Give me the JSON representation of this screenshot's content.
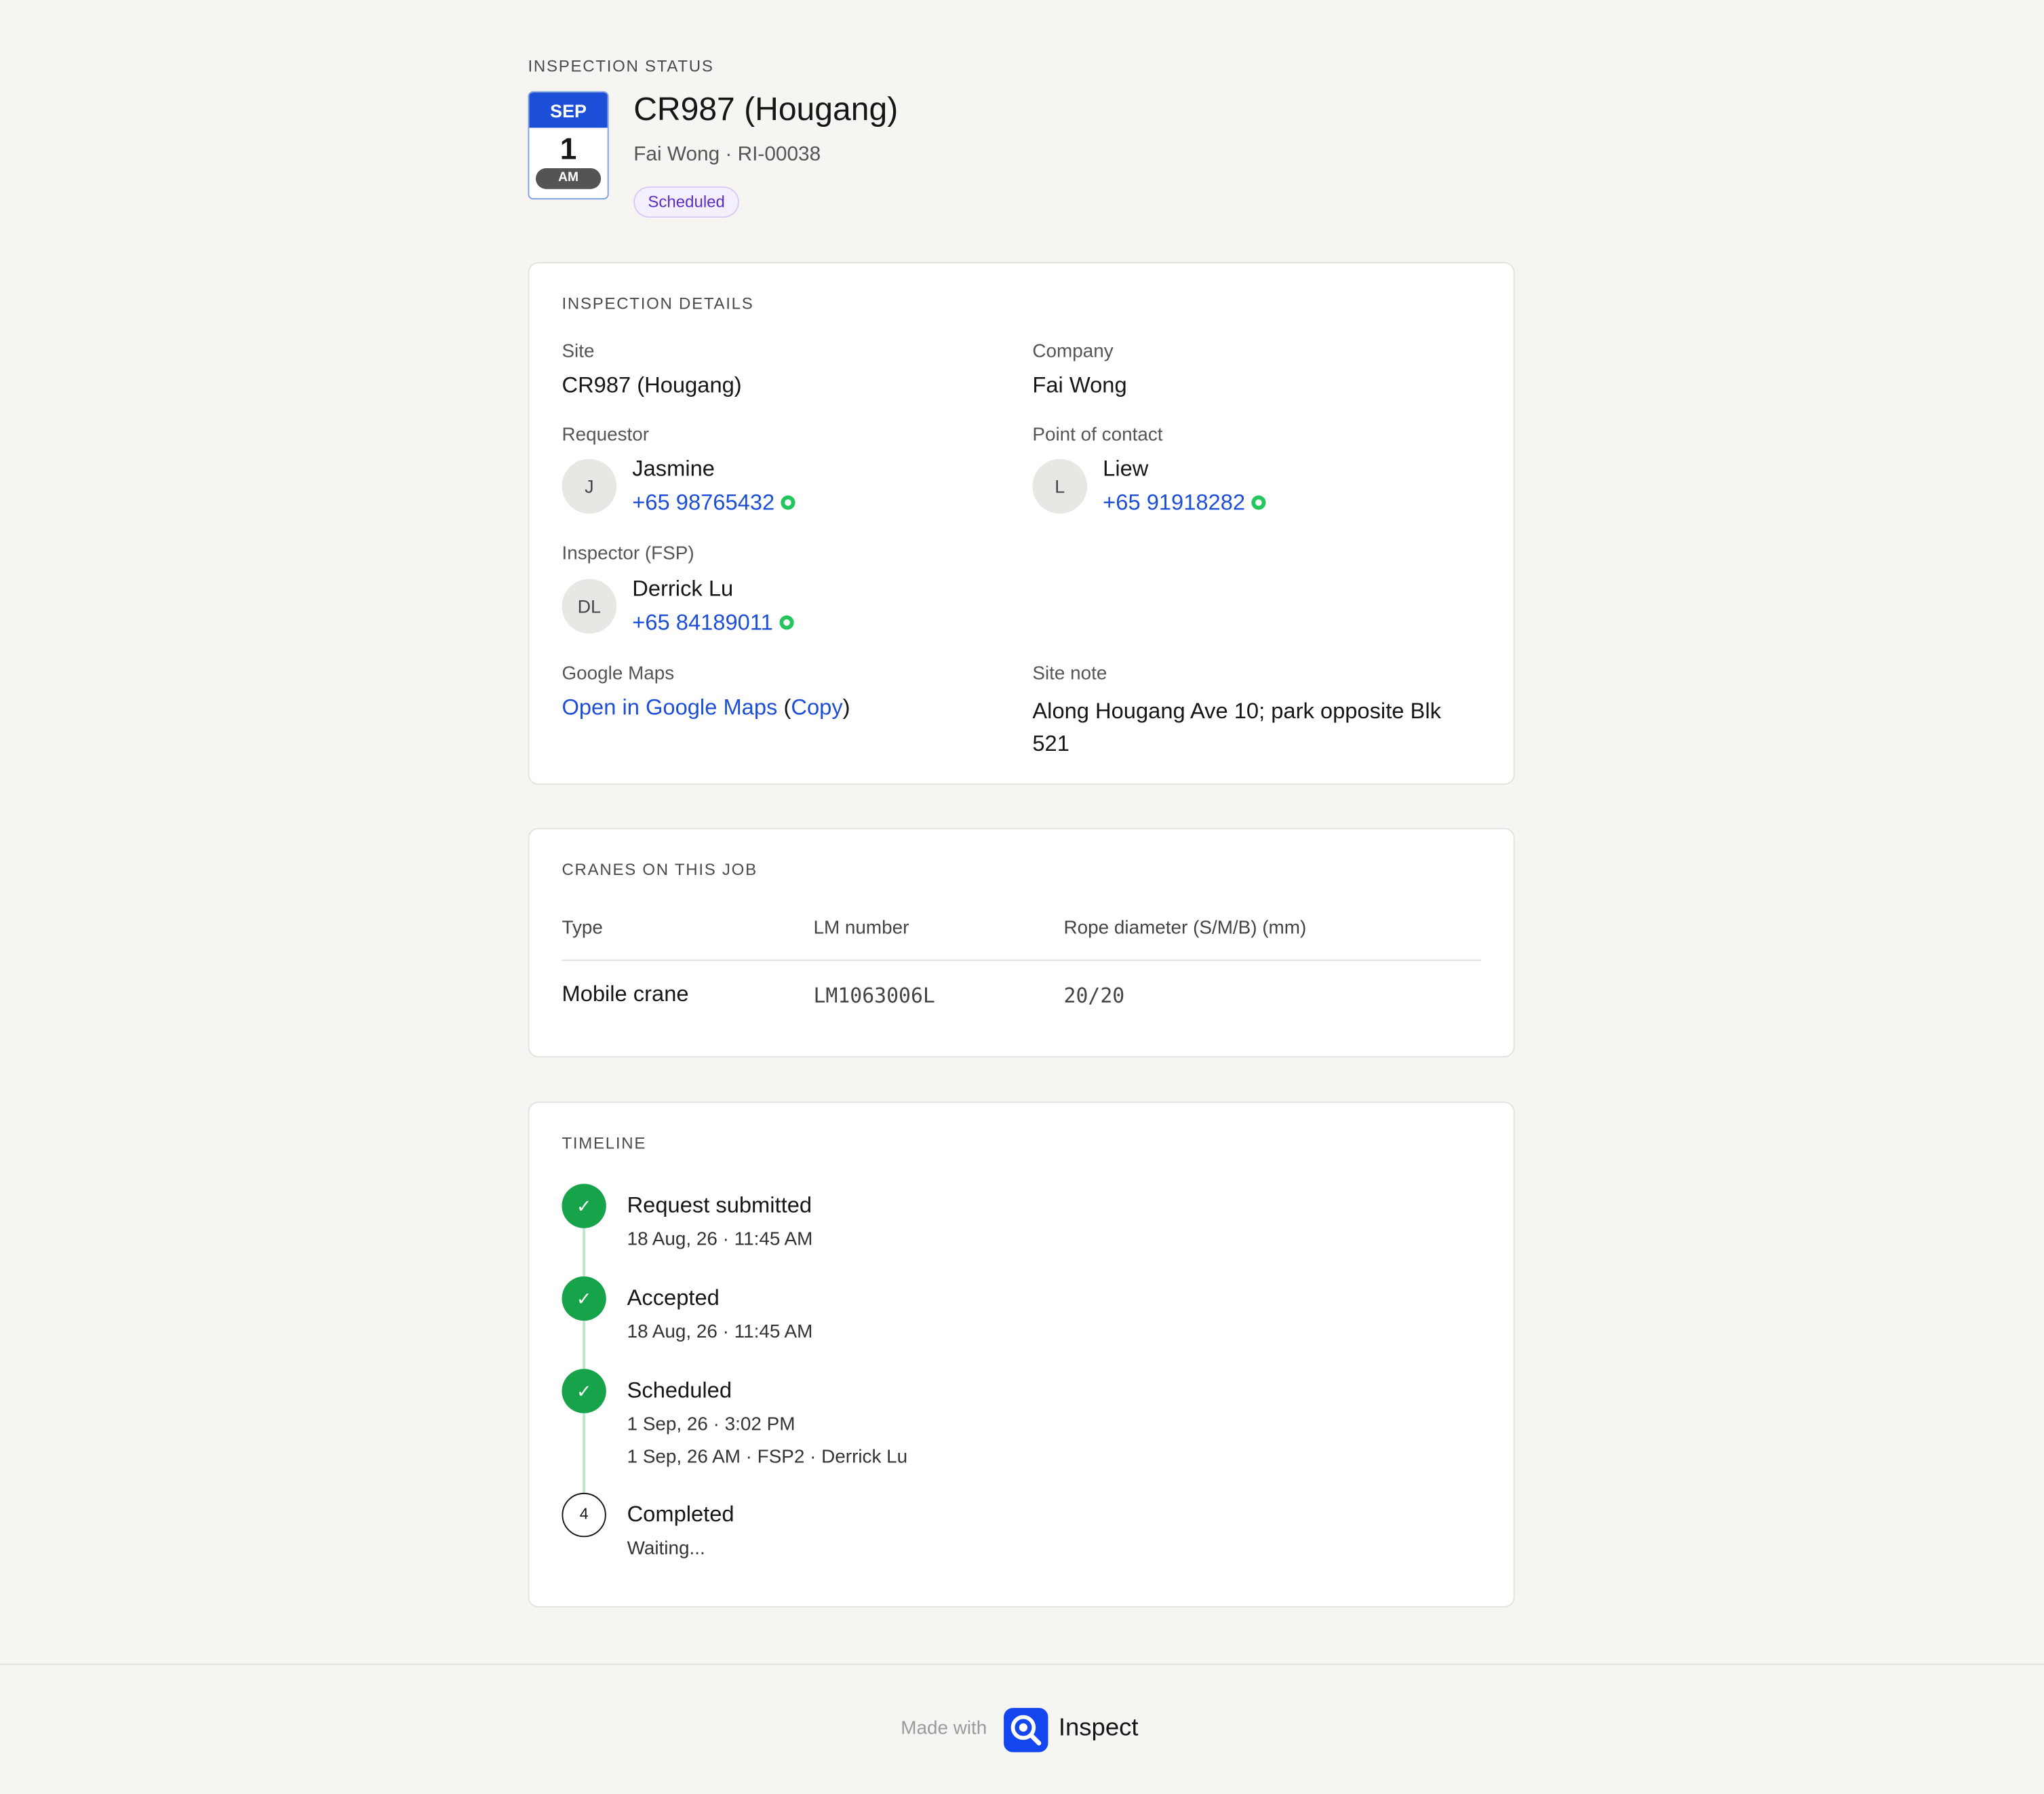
{
  "header": {
    "eyebrow": "INSPECTION STATUS",
    "date": {
      "month": "SEP",
      "day": "1",
      "ampm": "AM"
    },
    "title": "CR987 (Hougang)",
    "subtitle": "Fai Wong · RI-00038",
    "status": "Scheduled"
  },
  "details": {
    "heading": "INSPECTION DETAILS",
    "site_label": "Site",
    "site_value": "CR987 (Hougang)",
    "company_label": "Company",
    "company_value": "Fai Wong",
    "requestor_label": "Requestor",
    "requestor": {
      "initials": "J",
      "name": "Jasmine",
      "phone": "+65 98765432"
    },
    "poc_label": "Point of contact",
    "poc": {
      "initials": "L",
      "name": "Liew",
      "phone": "+65 91918282"
    },
    "inspector_label": "Inspector (FSP)",
    "inspector": {
      "initials": "DL",
      "name": "Derrick Lu",
      "phone": "+65 84189011"
    },
    "maps_label": "Google Maps",
    "maps_link": "Open in Google Maps",
    "maps_copy_open": "(",
    "maps_copy": "Copy",
    "maps_copy_close": ")",
    "note_label": "Site note",
    "note_value": "Along Hougang Ave 10; park opposite Blk 521"
  },
  "cranes": {
    "heading": "CRANES ON THIS JOB",
    "columns": [
      "Type",
      "LM number",
      "Rope diameter (S/M/B) (mm)"
    ],
    "rows": [
      {
        "type": "Mobile crane",
        "lm": "LM1063006L",
        "rope": "20/20"
      }
    ]
  },
  "timeline": {
    "heading": "TIMELINE",
    "steps": [
      {
        "marker": "✓",
        "title": "Request submitted",
        "lines": [
          "18 Aug, 26 · 11:45 AM"
        ]
      },
      {
        "marker": "✓",
        "title": "Accepted",
        "lines": [
          "18 Aug, 26 · 11:45 AM"
        ]
      },
      {
        "marker": "✓",
        "title": "Scheduled",
        "lines": [
          "1 Sep, 26 · 3:02 PM",
          "1 Sep, 26 AM · FSP2 · Derrick Lu"
        ]
      },
      {
        "marker": "4",
        "title": "Completed",
        "lines": [
          "Waiting..."
        ]
      }
    ]
  },
  "footer": {
    "made_with": "Made with",
    "brand": "Inspect"
  },
  "colors": {
    "accent": "#1d4ed8",
    "success": "#16a34a",
    "badge_text": "#5b2ec4",
    "brand": "#1446f0"
  },
  "icons": {
    "whatsapp": "whatsapp-icon",
    "check": "check-icon",
    "logo": "inspect-logo-icon"
  }
}
